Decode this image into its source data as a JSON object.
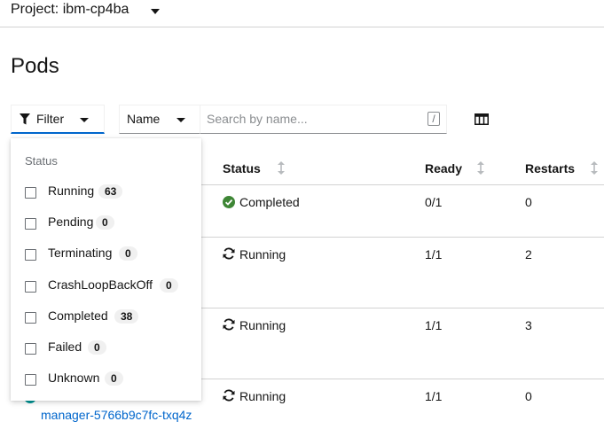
{
  "project": {
    "label": "Project: ibm-cp4ba"
  },
  "page": {
    "title": "Pods"
  },
  "toolbar": {
    "filter_label": "Filter",
    "name_select": "Name",
    "search_placeholder": "Search by name...",
    "search_value": "",
    "shortcut_key": "/"
  },
  "table": {
    "columns": [
      "Status",
      "Ready",
      "Restarts"
    ],
    "rows": [
      {
        "status": "Completed",
        "status_icon": "check-circle-icon",
        "ready": "0/1",
        "restarts": "0"
      },
      {
        "status": "Running",
        "status_icon": "sync-icon",
        "ready": "1/1",
        "restarts": "2"
      },
      {
        "status": "Running",
        "status_icon": "sync-icon",
        "ready": "1/1",
        "restarts": "3"
      },
      {
        "status": "Running",
        "status_icon": "sync-icon",
        "ready": "1/1",
        "restarts": "0",
        "name_partial": "manager-5766b9c7fc-txq4z"
      }
    ]
  },
  "filter_menu": {
    "heading": "Status",
    "items": [
      {
        "label": "Running",
        "count": "63",
        "checked": false
      },
      {
        "label": "Pending",
        "count": "0",
        "checked": false
      },
      {
        "label": "Terminating",
        "count": "0",
        "checked": false
      },
      {
        "label": "CrashLoopBackOff",
        "count": "0",
        "checked": false
      },
      {
        "label": "Completed",
        "count": "38",
        "checked": false
      },
      {
        "label": "Failed",
        "count": "0",
        "checked": false
      },
      {
        "label": "Unknown",
        "count": "0",
        "checked": false
      }
    ]
  },
  "colors": {
    "accent": "#0066cc",
    "success": "#3e8635",
    "border": "#d2d2d2",
    "muted": "#6a6e73",
    "pod_badge": "#009596"
  }
}
